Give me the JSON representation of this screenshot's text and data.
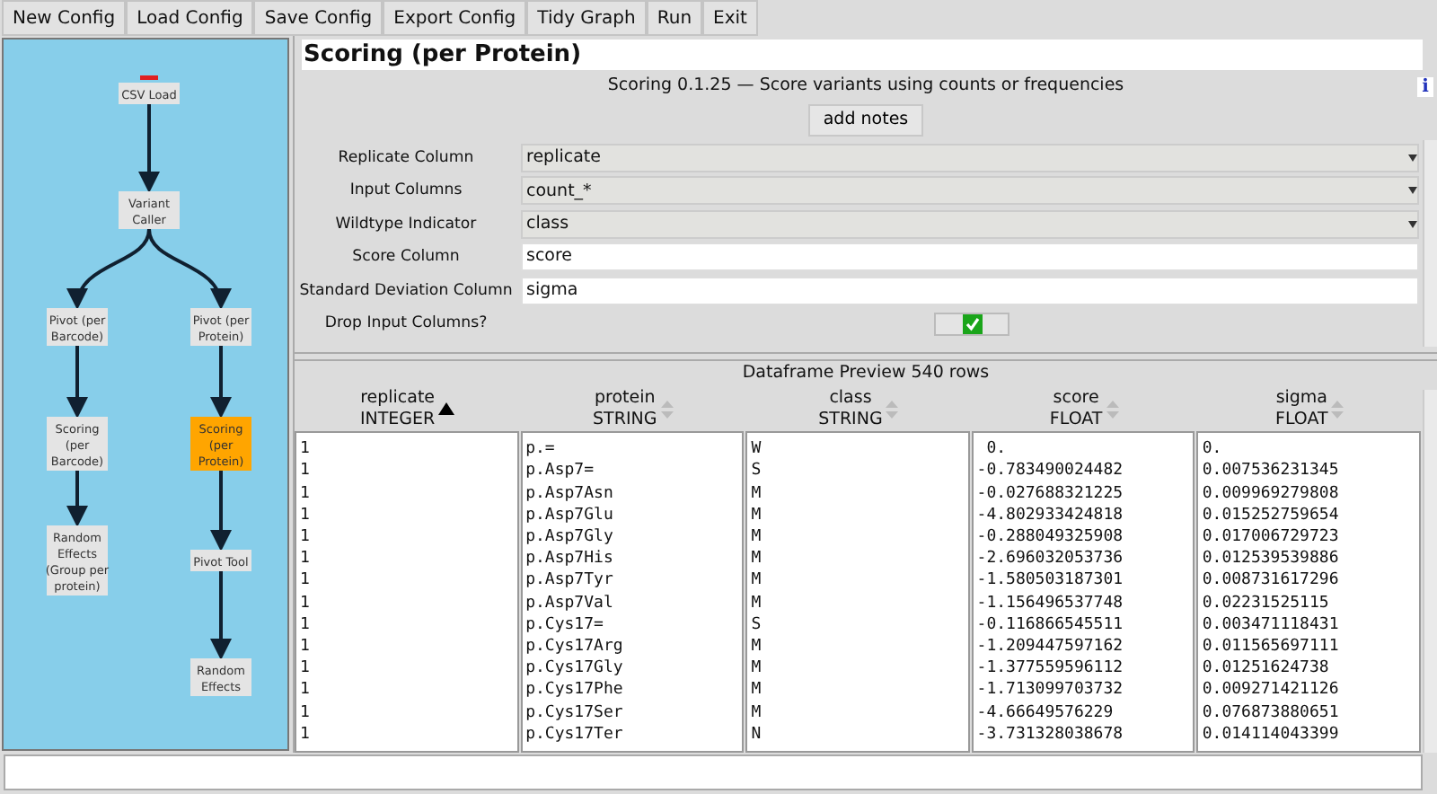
{
  "toolbar": [
    "New Config",
    "Load Config",
    "Save Config",
    "Export Config",
    "Tidy Graph",
    "Run",
    "Exit"
  ],
  "graph": {
    "lines": [
      "CSV Load"
    ],
    "selected": false,
    "error": true,
    "children": [
      {
        "lines": [
          "Variant",
          "Caller"
        ],
        "selected": false,
        "error": false,
        "children": [
          {
            "lines": [
              "Pivot (per",
              "Barcode)"
            ],
            "selected": false,
            "error": false,
            "children": [
              {
                "lines": [
                  "Scoring",
                  "(per",
                  "Barcode)"
                ],
                "selected": false,
                "error": false,
                "children": [
                  {
                    "lines": [
                      "Random",
                      "Effects",
                      "(Group per",
                      "protein)"
                    ],
                    "selected": false,
                    "error": false
                  }
                ]
              }
            ]
          },
          {
            "lines": [
              "Pivot (per",
              "Protein)"
            ],
            "selected": false,
            "error": false,
            "children": [
              {
                "lines": [
                  "Scoring",
                  "(per",
                  "Protein)"
                ],
                "selected": true,
                "error": false,
                "children": [
                  {
                    "lines": [
                      "Pivot Tool"
                    ],
                    "selected": false,
                    "error": false,
                    "children": [
                      {
                        "lines": [
                          "Random",
                          "Effects"
                        ],
                        "selected": false,
                        "error": false
                      }
                    ]
                  }
                ]
              }
            ]
          }
        ]
      }
    ]
  },
  "title": "Scoring (per Protein)",
  "description": "Scoring 0.1.25 — Score variants using counts or frequencies",
  "info_icon": "i",
  "notes_button": "add notes",
  "fields": [
    {
      "label": "Replicate Column",
      "kind": "select",
      "value": "replicate"
    },
    {
      "label": "Input Columns",
      "kind": "select",
      "value": "count_*"
    },
    {
      "label": "Wildtype Indicator",
      "kind": "select",
      "value": "class"
    },
    {
      "label": "Score Column",
      "kind": "text",
      "value": "score"
    },
    {
      "label": "Standard Deviation Column",
      "kind": "text",
      "value": "sigma"
    },
    {
      "label": "Drop Input Columns?",
      "kind": "checkbox",
      "checked": true
    }
  ],
  "preview": {
    "title": "Dataframe Preview 540 rows",
    "columns": [
      {
        "name": "replicate",
        "type": "INTEGER",
        "sorted": true,
        "cells": [
          "1",
          "1",
          "1",
          "1",
          "1",
          "1",
          "1",
          "1",
          "1",
          "1",
          "1",
          "1",
          "1",
          "1"
        ]
      },
      {
        "name": "protein",
        "type": "STRING",
        "sorted": false,
        "cells": [
          "p.=",
          "p.Asp7=",
          "p.Asp7Asn",
          "p.Asp7Glu",
          "p.Asp7Gly",
          "p.Asp7His",
          "p.Asp7Tyr",
          "p.Asp7Val",
          "p.Cys17=",
          "p.Cys17Arg",
          "p.Cys17Gly",
          "p.Cys17Phe",
          "p.Cys17Ser",
          "p.Cys17Ter"
        ]
      },
      {
        "name": "class",
        "type": "STRING",
        "sorted": false,
        "cells": [
          "W",
          "S",
          "M",
          "M",
          "M",
          "M",
          "M",
          "M",
          "S",
          "M",
          "M",
          "M",
          "M",
          "N"
        ]
      },
      {
        "name": "score",
        "type": "FLOAT",
        "sorted": false,
        "cells": [
          " 0.",
          "-0.783490024482",
          "-0.027688321225",
          "-4.802933424818",
          "-0.288049325908",
          "-2.696032053736",
          "-1.580503187301",
          "-1.156496537748",
          "-0.116866545511",
          "-1.209447597162",
          "-1.377559596112",
          "-1.713099703732",
          "-4.66649576229",
          "-3.731328038678"
        ]
      },
      {
        "name": "sigma",
        "type": "FLOAT",
        "sorted": false,
        "cells": [
          "0.",
          "0.007536231345",
          "0.009969279808",
          "0.015252759654",
          "0.017006729723",
          "0.012539539886",
          "0.008731617296",
          "0.02231525115",
          "0.003471118431",
          "0.011565697111",
          "0.01251624738",
          "0.009271421126",
          "0.076873880651",
          "0.014114043399"
        ]
      }
    ]
  }
}
